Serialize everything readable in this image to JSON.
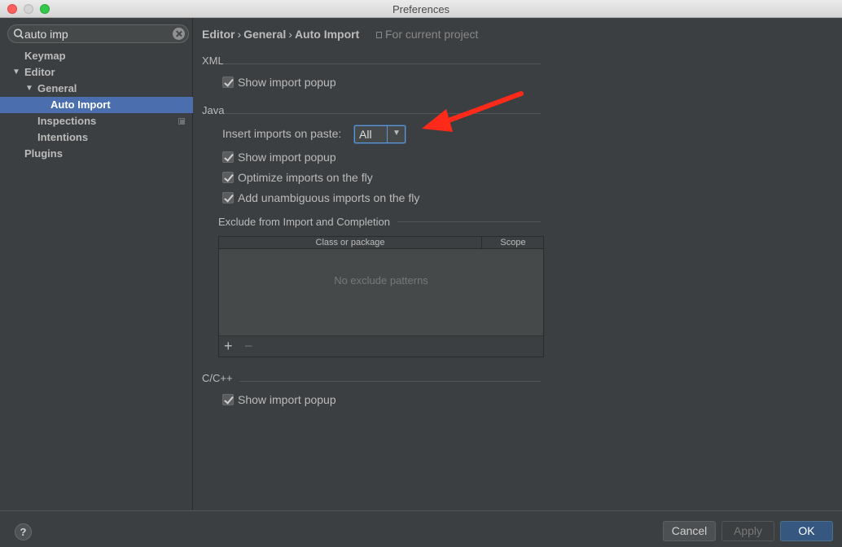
{
  "window": {
    "title": "Preferences"
  },
  "search": {
    "value": "auto imp",
    "placeholder": ""
  },
  "tree": {
    "keymap": "Keymap",
    "editor": "Editor",
    "general": "General",
    "auto_import": "Auto Import",
    "inspections": "Inspections",
    "intentions": "Intentions",
    "plugins": "Plugins"
  },
  "breadcrumb": {
    "parts": [
      "Editor",
      "General",
      "Auto Import"
    ],
    "separator": "›",
    "scope_hint": "For current project"
  },
  "xml": {
    "title": "XML",
    "show_import_popup": {
      "label": "Show import popup",
      "checked": true
    }
  },
  "java": {
    "title": "Java",
    "insert_imports_label": "Insert imports on paste:",
    "insert_imports_value": "All",
    "show_import_popup": {
      "label": "Show import popup",
      "checked": true
    },
    "optimize_imports": {
      "label": "Optimize imports on the fly",
      "checked": true
    },
    "add_unambiguous": {
      "label": "Add unambiguous imports on the fly",
      "checked": true
    },
    "exclude": {
      "title": "Exclude from Import and Completion",
      "columns": [
        "Class or package",
        "Scope"
      ],
      "empty_text": "No exclude patterns",
      "add_label": "+",
      "remove_label": "−"
    }
  },
  "cpp": {
    "title": "C/C++",
    "show_import_popup": {
      "label": "Show import popup",
      "checked": true
    }
  },
  "buttons": {
    "help": "?",
    "cancel": "Cancel",
    "apply": "Apply",
    "ok": "OK"
  },
  "colors": {
    "selection": "#4b6eaf",
    "annotation_arrow": "#ff2a1a",
    "ok_button": "#365880"
  }
}
